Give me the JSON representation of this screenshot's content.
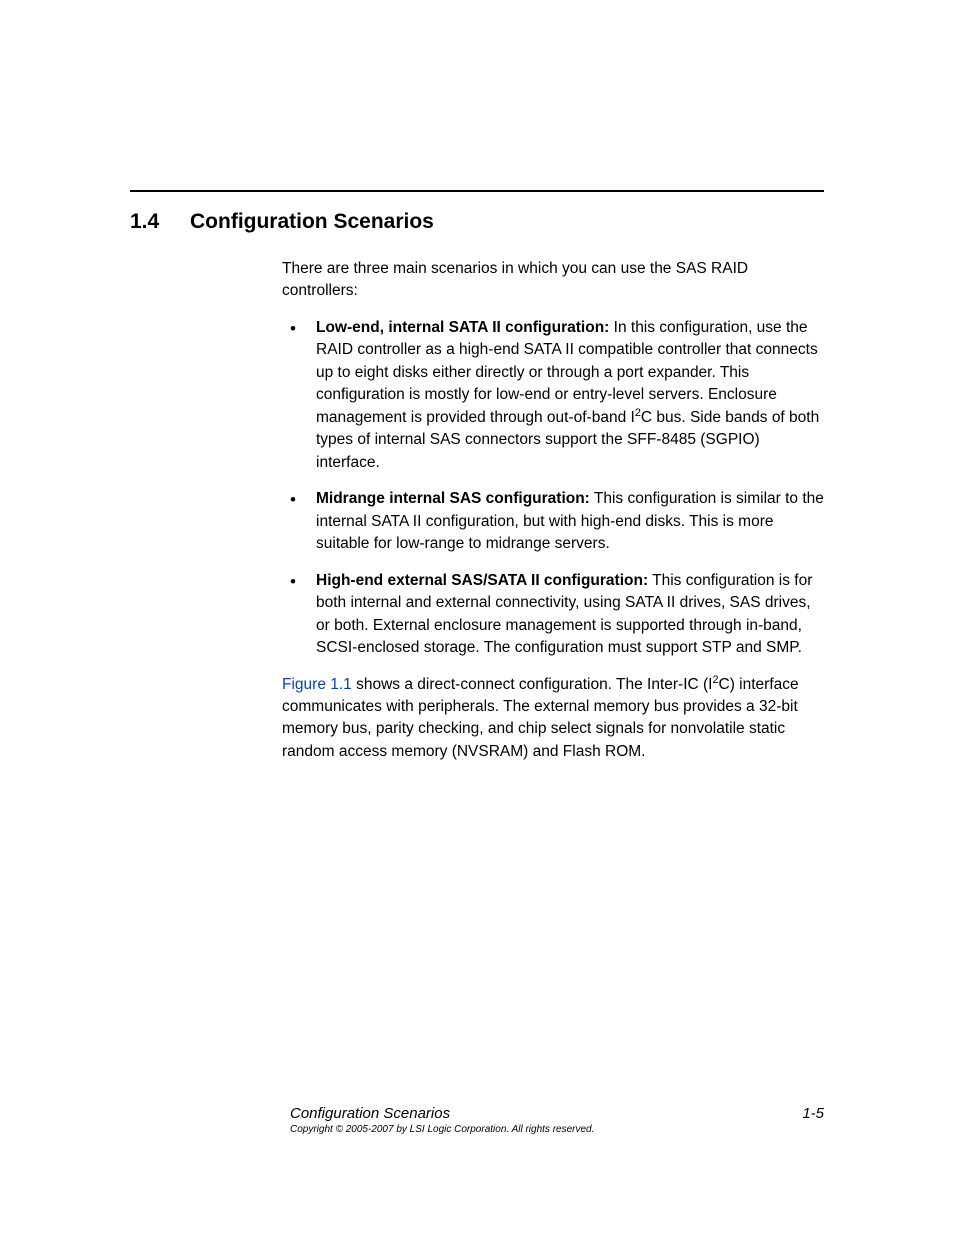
{
  "heading": {
    "number": "1.4",
    "title": "Configuration Scenarios"
  },
  "intro": "There are three main scenarios in which you can use the SAS RAID controllers:",
  "bullets": [
    {
      "label": "Low-end, internal SATA II configuration:",
      "text_before": " In this configuration, use the RAID controller as a high-end SATA II compatible controller that connects up to eight disks either directly or through a port expander. This configuration is mostly for low-end or entry-level servers. Enclosure management is provided through out-of-band I",
      "sup": "2",
      "text_after": "C bus. Side bands of both types of internal SAS connectors support the SFF-8485 (SGPIO) interface."
    },
    {
      "label": "Midrange internal SAS configuration:",
      "text": " This configuration is similar to the internal SATA II configuration, but with high-end disks. This is more suitable for low-range to midrange servers."
    },
    {
      "label": "High-end external SAS/SATA II configuration:",
      "text": " This configuration is for both internal and external connectivity, using SATA II drives, SAS drives, or both. External enclosure management is supported through in-band, SCSI-enclosed storage. The configuration must support STP and SMP."
    }
  ],
  "closing": {
    "link": "Figure 1.1",
    "before_sup": " shows a direct-connect configuration. The Inter-IC (I",
    "sup": "2",
    "after_sup": "C) interface communicates with peripherals. The external memory bus provides a 32-bit memory bus, parity checking, and chip select signals for nonvolatile static random access memory (NVSRAM) and Flash ROM."
  },
  "footer": {
    "section": "Configuration Scenarios",
    "page": "1-5",
    "copyright": "Copyright © 2005-2007 by LSI Logic Corporation. All rights reserved."
  }
}
